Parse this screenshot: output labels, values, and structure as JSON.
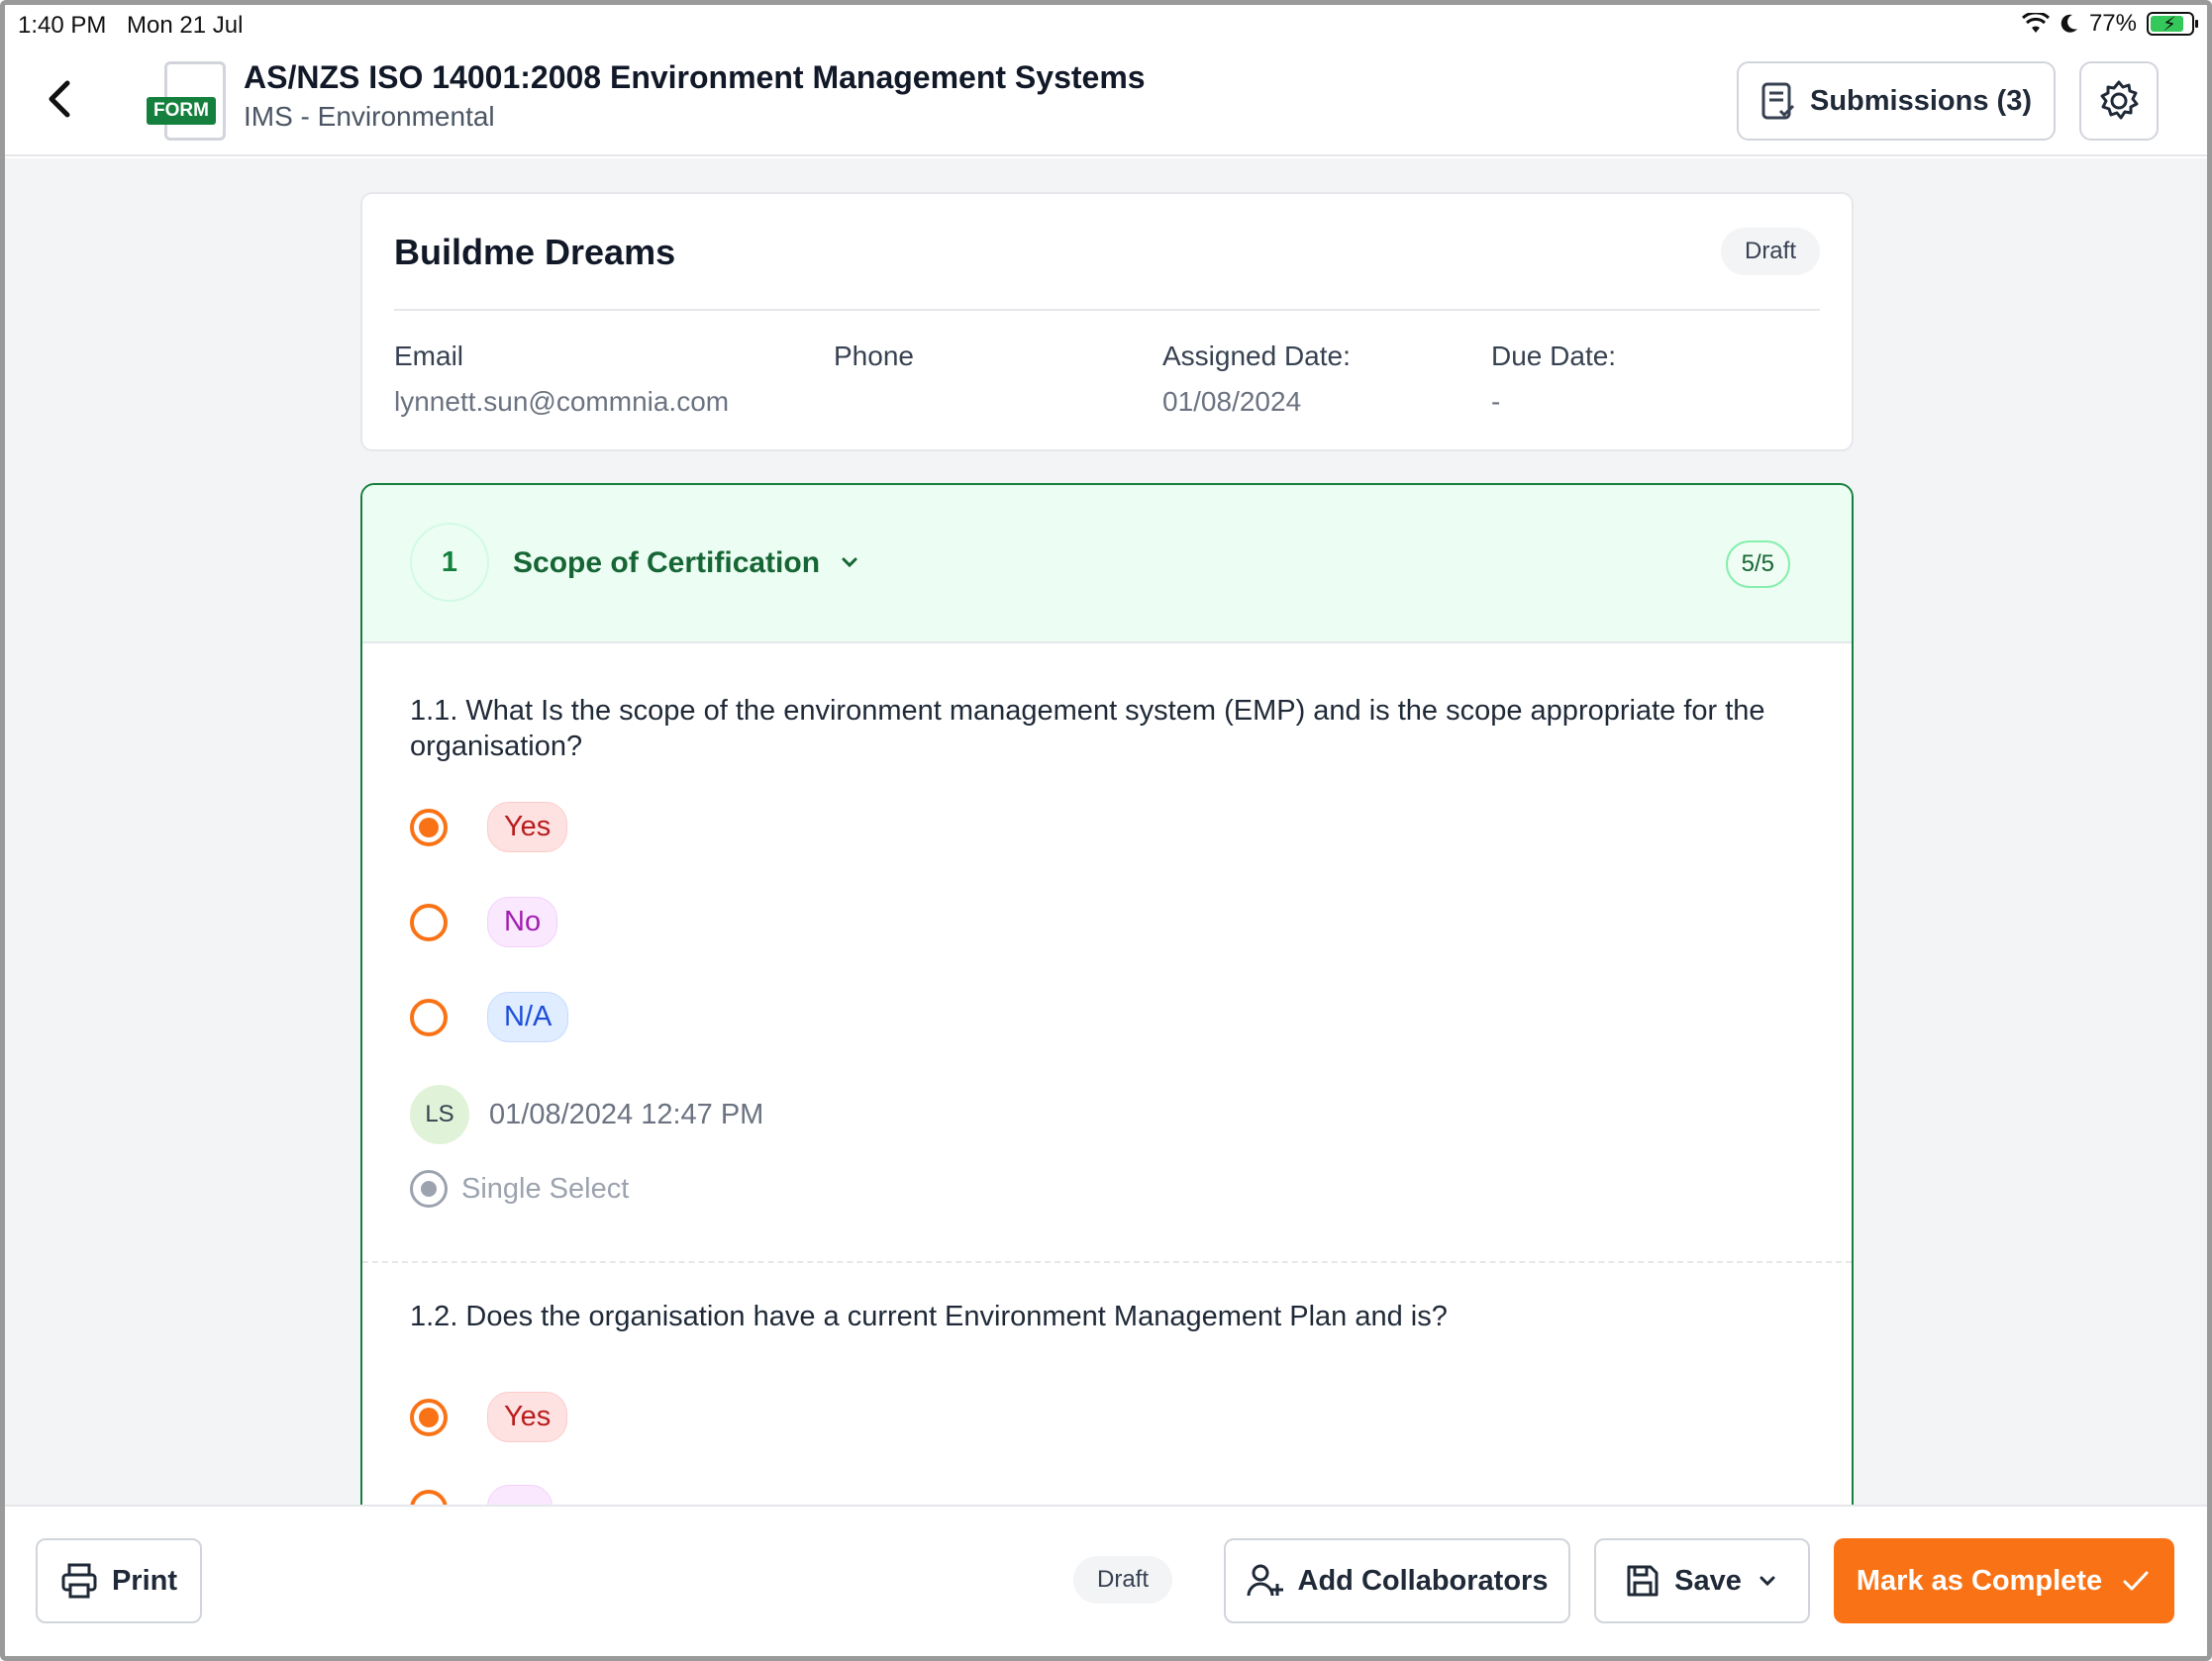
{
  "status_bar": {
    "time": "1:40 PM",
    "date": "Mon 21 Jul",
    "battery": "77%"
  },
  "header": {
    "form_tag": "FORM",
    "title": "AS/NZS ISO 14001:2008 Environment Management Systems",
    "subtitle": "IMS - Environmental",
    "submissions_label": "Submissions (3)"
  },
  "client": {
    "name": "Buildme Dreams",
    "status": "Draft",
    "fields": {
      "email_label": "Email",
      "email_value": "lynnett.sun@commnia.com",
      "phone_label": "Phone",
      "assigned_label": "Assigned Date:",
      "assigned_value": "01/08/2024",
      "due_label": "Due Date:",
      "due_value": "-"
    }
  },
  "section": {
    "number": "1",
    "title": "Scope of Certification",
    "progress": "5/5",
    "questions": [
      {
        "text": "1.1. What Is the scope of the environment management system (EMP) and is the scope appropriate for the organisation?",
        "options": [
          "Yes",
          "No",
          "N/A"
        ],
        "selected": "Yes",
        "responder_initials": "LS",
        "timestamp": "01/08/2024 12:47 PM",
        "type": "Single Select"
      },
      {
        "text": "1.2. Does the organisation have a current Environment Management Plan and is?",
        "options": [
          "Yes"
        ],
        "selected": "Yes"
      }
    ]
  },
  "footer": {
    "print_label": "Print",
    "status": "Draft",
    "collaborators_label": "Add Collaborators",
    "save_label": "Save",
    "complete_label": "Mark as Complete"
  },
  "colors": {
    "accent": "#f97316",
    "brand_green": "#15803d"
  }
}
